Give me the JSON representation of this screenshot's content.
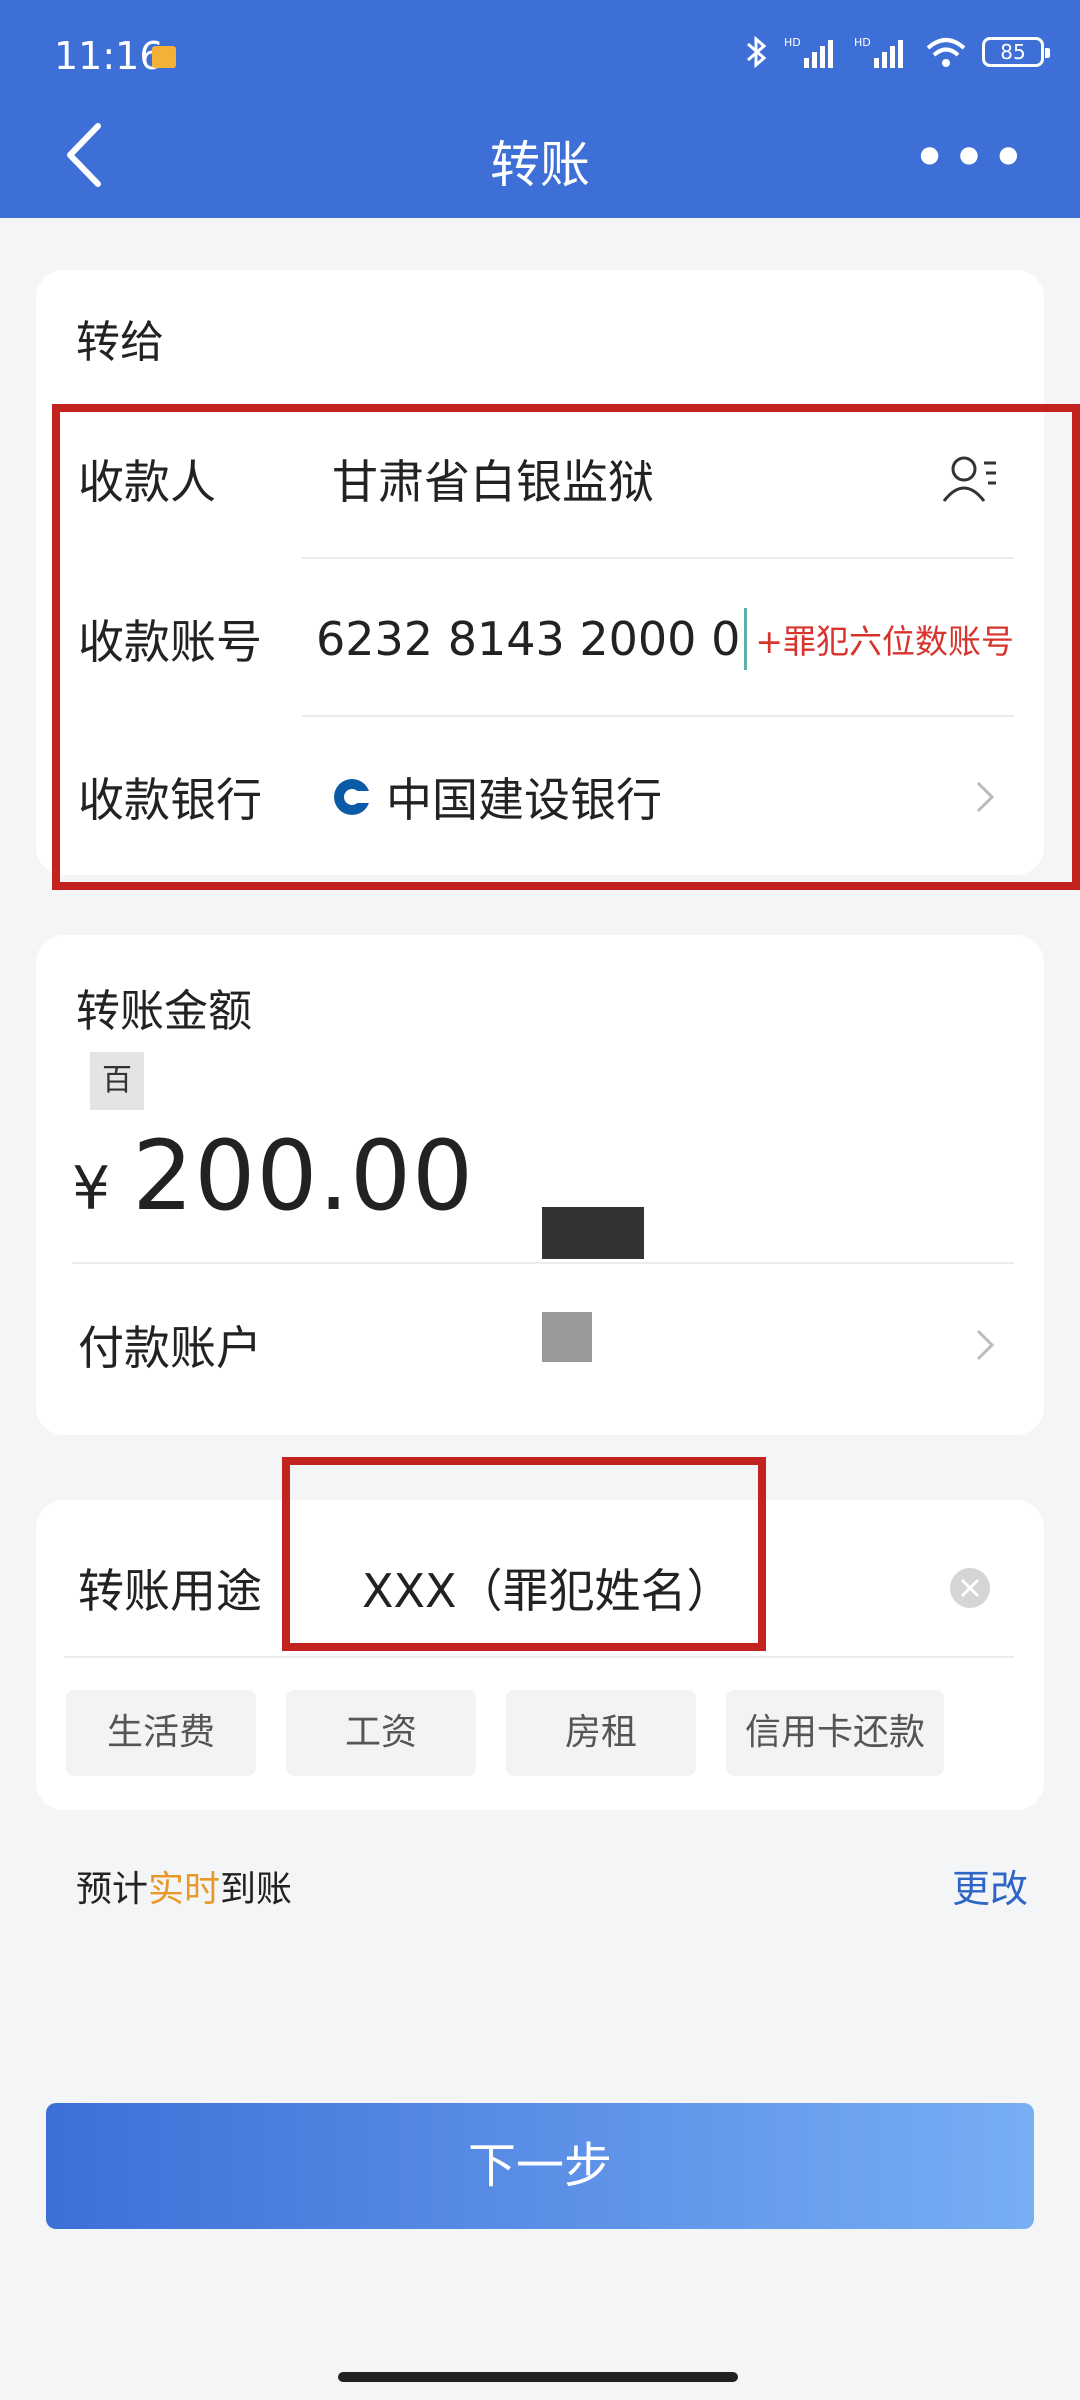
{
  "status_bar": {
    "time": "11:16",
    "battery": "85"
  },
  "header": {
    "title": "转账"
  },
  "recipient": {
    "section_label": "转给",
    "payee_label": "收款人",
    "payee_value": "甘肃省白银监狱",
    "account_label": "收款账号",
    "account_value": "6232 8143 2000 0",
    "account_note": "+罪犯六位数账号",
    "bank_label": "收款银行",
    "bank_value": "中国建设银行"
  },
  "amount": {
    "section_label": "转账金额",
    "unit_tag": "百",
    "currency": "¥",
    "value": "200.00",
    "pay_account_label": "付款账户"
  },
  "purpose": {
    "label": "转账用途",
    "value": "XXX（罪犯姓名）",
    "chips": [
      "生活费",
      "工资",
      "房租",
      "信用卡还款"
    ]
  },
  "arrival": {
    "prefix": "预计",
    "highlight": "实时",
    "suffix": "到账",
    "change_label": "更改"
  },
  "footer": {
    "next_label": "下一步"
  },
  "colors": {
    "brand": "#3d6fd6",
    "annotation_red": "#c2231e",
    "highlight_orange": "#e79a28"
  }
}
